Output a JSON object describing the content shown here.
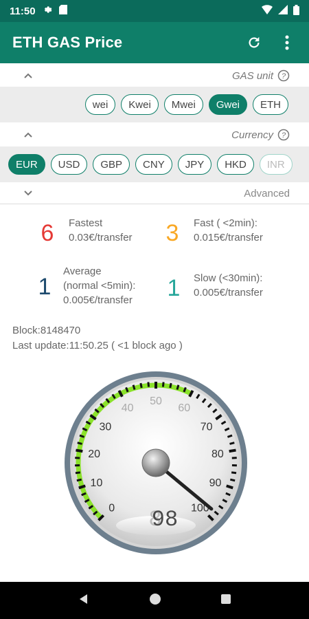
{
  "status": {
    "time": "11:50",
    "icons": [
      "gear-icon",
      "sd-card-icon",
      "wifi-icon",
      "signal-icon",
      "battery-icon"
    ]
  },
  "appbar": {
    "title": "ETH GAS Price",
    "refresh_icon": "refresh-icon",
    "menu_icon": "more-vert-icon"
  },
  "gas_unit": {
    "label": "GAS unit",
    "options": [
      "wei",
      "Kwei",
      "Mwei",
      "Gwei",
      "ETH"
    ],
    "selected": "Gwei"
  },
  "currency": {
    "label": "Currency",
    "options": [
      "EUR",
      "USD",
      "GBP",
      "CNY",
      "JPY",
      "HKD",
      "INR"
    ],
    "selected": "EUR"
  },
  "advanced": {
    "label": "Advanced"
  },
  "prices": {
    "fastest": {
      "value": "6",
      "line1": "Fastest",
      "line2": "0.03€/transfer",
      "color": "#e53935"
    },
    "fast": {
      "value": "3",
      "line1": "Fast ( <2min):",
      "line2": "0.015€/transfer",
      "color": "#f9a825"
    },
    "average": {
      "value": "1",
      "line1": "Average",
      "line2": "(normal <5min):",
      "line3": "0.005€/transfer",
      "color": "#1e4b6e"
    },
    "slow": {
      "value": "1",
      "line1": "Slow (<30min):",
      "line2": "0.005€/transfer",
      "color": "#26a69a"
    }
  },
  "block": {
    "block_text": "Block:8148470",
    "update_text": "Last update:11:50.25   ( <1 block ago )"
  },
  "gauge": {
    "min": 0,
    "max": 100,
    "value": 98,
    "display": "98",
    "ticks": [
      "0",
      "10",
      "20",
      "30",
      "40",
      "50",
      "60",
      "70",
      "80",
      "90",
      "100"
    ]
  },
  "nav": {
    "icons": [
      "back-icon",
      "home-icon",
      "recents-icon"
    ]
  },
  "colors": {
    "primary": "#0f7f69",
    "status": "#0b6b5b",
    "gauge_green": "#8be22b"
  }
}
